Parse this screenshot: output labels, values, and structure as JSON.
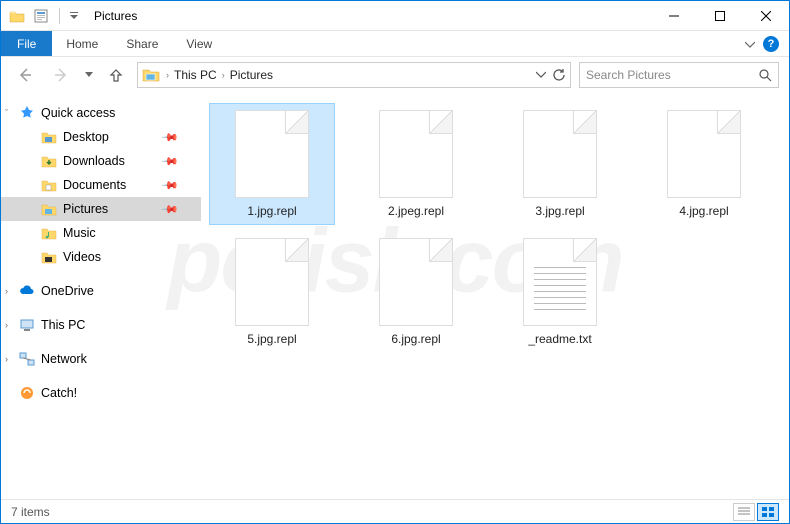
{
  "window": {
    "title": "Pictures"
  },
  "ribbon": {
    "file": "File",
    "tabs": [
      "Home",
      "Share",
      "View"
    ]
  },
  "breadcrumb": {
    "segments": [
      "This PC",
      "Pictures"
    ]
  },
  "search": {
    "placeholder": "Search Pictures"
  },
  "sidebar": {
    "quick_access": "Quick access",
    "quick_items": [
      {
        "label": "Desktop",
        "pinned": true
      },
      {
        "label": "Downloads",
        "pinned": true
      },
      {
        "label": "Documents",
        "pinned": true
      },
      {
        "label": "Pictures",
        "pinned": true,
        "selected": true
      },
      {
        "label": "Music",
        "pinned": false
      },
      {
        "label": "Videos",
        "pinned": false
      }
    ],
    "onedrive": "OneDrive",
    "this_pc": "This PC",
    "network": "Network",
    "catch": "Catch!"
  },
  "files": [
    {
      "name": "1.jpg.repl",
      "type": "file",
      "selected": true
    },
    {
      "name": "2.jpeg.repl",
      "type": "file"
    },
    {
      "name": "3.jpg.repl",
      "type": "file"
    },
    {
      "name": "4.jpg.repl",
      "type": "file"
    },
    {
      "name": "5.jpg.repl",
      "type": "file"
    },
    {
      "name": "6.jpg.repl",
      "type": "file"
    },
    {
      "name": "_readme.txt",
      "type": "text"
    }
  ],
  "status": {
    "count": "7 items"
  },
  "watermark": "pcrisk.com"
}
